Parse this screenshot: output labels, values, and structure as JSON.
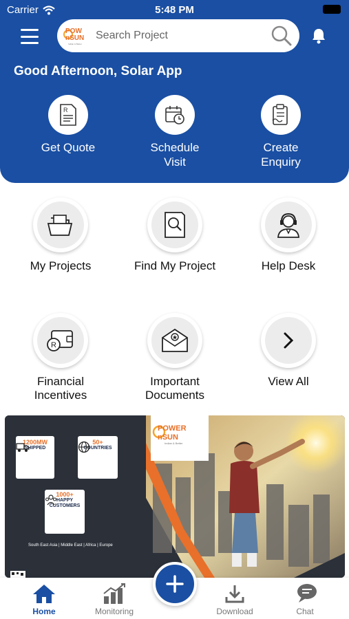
{
  "status_bar": {
    "carrier": "Carrier",
    "time": "5:48 PM"
  },
  "header": {
    "search_placeholder": "Search Project",
    "greeting": "Good Afternoon, Solar App",
    "quick_actions": [
      {
        "label": "Get Quote",
        "icon": "quote-document-icon"
      },
      {
        "label": "Schedule Visit",
        "icon": "calendar-clock-icon"
      },
      {
        "label": "Create Enquiry",
        "icon": "clipboard-enquiry-icon"
      }
    ]
  },
  "services": [
    {
      "label": "My Projects",
      "icon": "folder-icon"
    },
    {
      "label": "Find My Project",
      "icon": "document-search-icon"
    },
    {
      "label": "Help Desk",
      "icon": "support-agent-icon"
    },
    {
      "label": "Financial Incentives",
      "icon": "wallet-icon"
    },
    {
      "label": "Important Documents",
      "icon": "envelope-icon"
    },
    {
      "label": "View All",
      "icon": "chevron-right-icon"
    }
  ],
  "banner": {
    "stats": [
      {
        "value": "1200MW",
        "text": "SHIPPED"
      },
      {
        "value": "50+",
        "text": "COUNTRIES"
      },
      {
        "value": "1000+",
        "text": "HAPPY CUSTOMERS"
      }
    ],
    "regions": "South East Asia | Middle East | Africa | Europe"
  },
  "bottom_nav": {
    "tabs": [
      "Home",
      "Monitoring",
      "Download",
      "Chat"
    ],
    "active": "Home"
  },
  "colors": {
    "primary": "#1a4fa3",
    "accent": "#e8702a",
    "background": "#ffffff"
  }
}
